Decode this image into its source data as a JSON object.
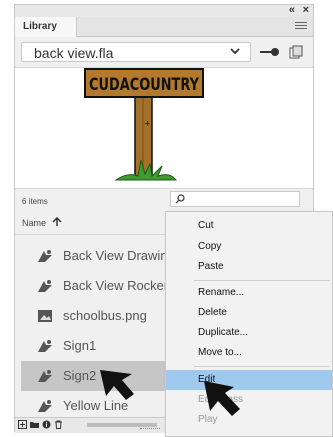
{
  "panel": {
    "title_controls": {
      "collapse": "«",
      "close": "×"
    },
    "tab_label": "Library",
    "document": {
      "selected": "back view.fla"
    },
    "item_count": "6 items",
    "search": {
      "placeholder": ""
    },
    "column_header": "Name"
  },
  "items": [
    {
      "name": "Back View Drawing",
      "icon": "graphic-symbol-icon"
    },
    {
      "name": "Back View Rocken",
      "icon": "graphic-symbol-icon"
    },
    {
      "name": "schoolbus.png",
      "icon": "bitmap-icon"
    },
    {
      "name": "Sign1",
      "icon": "graphic-symbol-icon"
    },
    {
      "name": "Sign2",
      "icon": "graphic-symbol-icon",
      "selected": true
    },
    {
      "name": "Yellow Line",
      "icon": "graphic-symbol-icon"
    }
  ],
  "preview": {
    "sign_text": "CUDACOUNTRY"
  },
  "context_menu": {
    "items": [
      {
        "label": "Cut"
      },
      {
        "label": "Copy"
      },
      {
        "label": "Paste"
      },
      {
        "label": "Rename..."
      },
      {
        "label": "Delete"
      },
      {
        "label": "Duplicate..."
      },
      {
        "label": "Move to..."
      },
      {
        "label": "Edit",
        "highlighted": true
      },
      {
        "label": "Edit Class"
      },
      {
        "label": "Play"
      }
    ]
  },
  "colors": {
    "highlight": "#9fc9ef",
    "selected_row": "#c6c6c6",
    "sign_wood": "#a4712a"
  }
}
